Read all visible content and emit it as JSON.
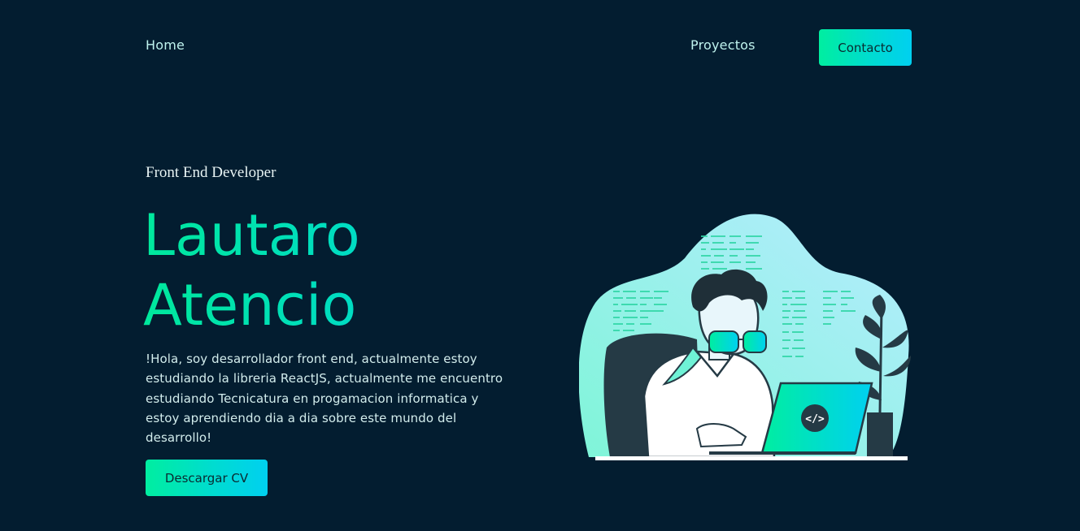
{
  "nav": {
    "home_label": "Home",
    "projects_label": "Proyectos",
    "contact_label": "Contacto"
  },
  "hero": {
    "subtitle": "Front End Developer",
    "first_name": "Lautaro",
    "last_name": "Atencio",
    "bio": "!Hola, soy desarrollador front end, actualmente estoy estudiando la libreria ReactJS, actualmente me encuentro estudiando Tecnicatura en progamacion informatica y estoy aprendiendo dia a dia sobre este mundo del desarrollo!",
    "cv_button_label": "Descargar CV",
    "laptop_code_glyph": "</>"
  },
  "colors": {
    "background": "#031d30",
    "accent_start": "#00eea0",
    "accent_end": "#00d0f0",
    "nav_text": "#bff3ee"
  },
  "icons": {
    "illustration": "developer-at-laptop-illustration",
    "laptop_logo": "code-brackets-icon"
  }
}
